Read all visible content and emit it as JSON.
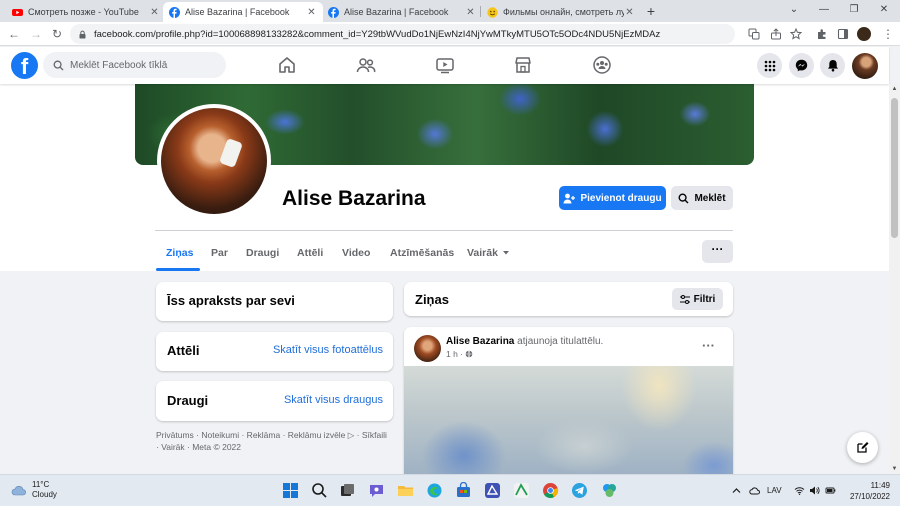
{
  "browser": {
    "tabs": [
      {
        "title": "Смотреть позже - YouTube",
        "favicon": "youtube-icon",
        "active": false
      },
      {
        "title": "Alise Bazarina | Facebook",
        "favicon": "facebook-icon",
        "active": true
      },
      {
        "title": "Alise Bazarina | Facebook",
        "favicon": "facebook-icon",
        "active": false
      },
      {
        "title": "Фильмы онлайн, смотреть лучшие",
        "favicon": "emoji-icon",
        "active": false
      }
    ],
    "new_tab": "+",
    "address": "facebook.com/profile.php?id=100068898133282&comment_id=Y29tbWVudDo1NjEwNzI4NjYwMTkyMTU5OTc5ODc4NDU5NjEzMDAz",
    "nav": {
      "back": "←",
      "forward": "→",
      "reload": "↻"
    }
  },
  "facebook": {
    "logo": "f",
    "search_placeholder": "Meklēt Facebook tīklā",
    "brand_color": "#1877f2"
  },
  "profile": {
    "name": "Alise Bazarina",
    "add_friend_label": "Pievienot draugu",
    "search_label": "Meklēt",
    "tabs": [
      {
        "label": "Ziņas",
        "active": true
      },
      {
        "label": "Par",
        "active": false
      },
      {
        "label": "Draugi",
        "active": false
      },
      {
        "label": "Attēli",
        "active": false
      },
      {
        "label": "Video",
        "active": false
      },
      {
        "label": "Atzīmēšanās",
        "active": false
      },
      {
        "label": "Vairāk",
        "active": false
      }
    ],
    "more_button": "···"
  },
  "sidebar": {
    "intro_title": "Īss apraksts par sevi",
    "photos_title": "Attēli",
    "photos_link": "Skatīt visus fotoattēlus",
    "friends_title": "Draugi",
    "friends_link": "Skatīt visus draugus",
    "footer": "Privātums · Noteikumi · Reklāma · Reklāmu izvēle ▷ · Sīkfaili · Vairāk · Meta © 2022"
  },
  "feed": {
    "title": "Ziņas",
    "filters_label": "Filtri",
    "post": {
      "author": "Alise Bazarina",
      "action": "atjaunoja titulattēlu.",
      "time": "1 h ·",
      "more": "···"
    }
  },
  "taskbar": {
    "weather_temp": "11°C",
    "weather_desc": "Cloudy",
    "language": "LAV",
    "time": "11:49",
    "date": "27/10/2022"
  }
}
